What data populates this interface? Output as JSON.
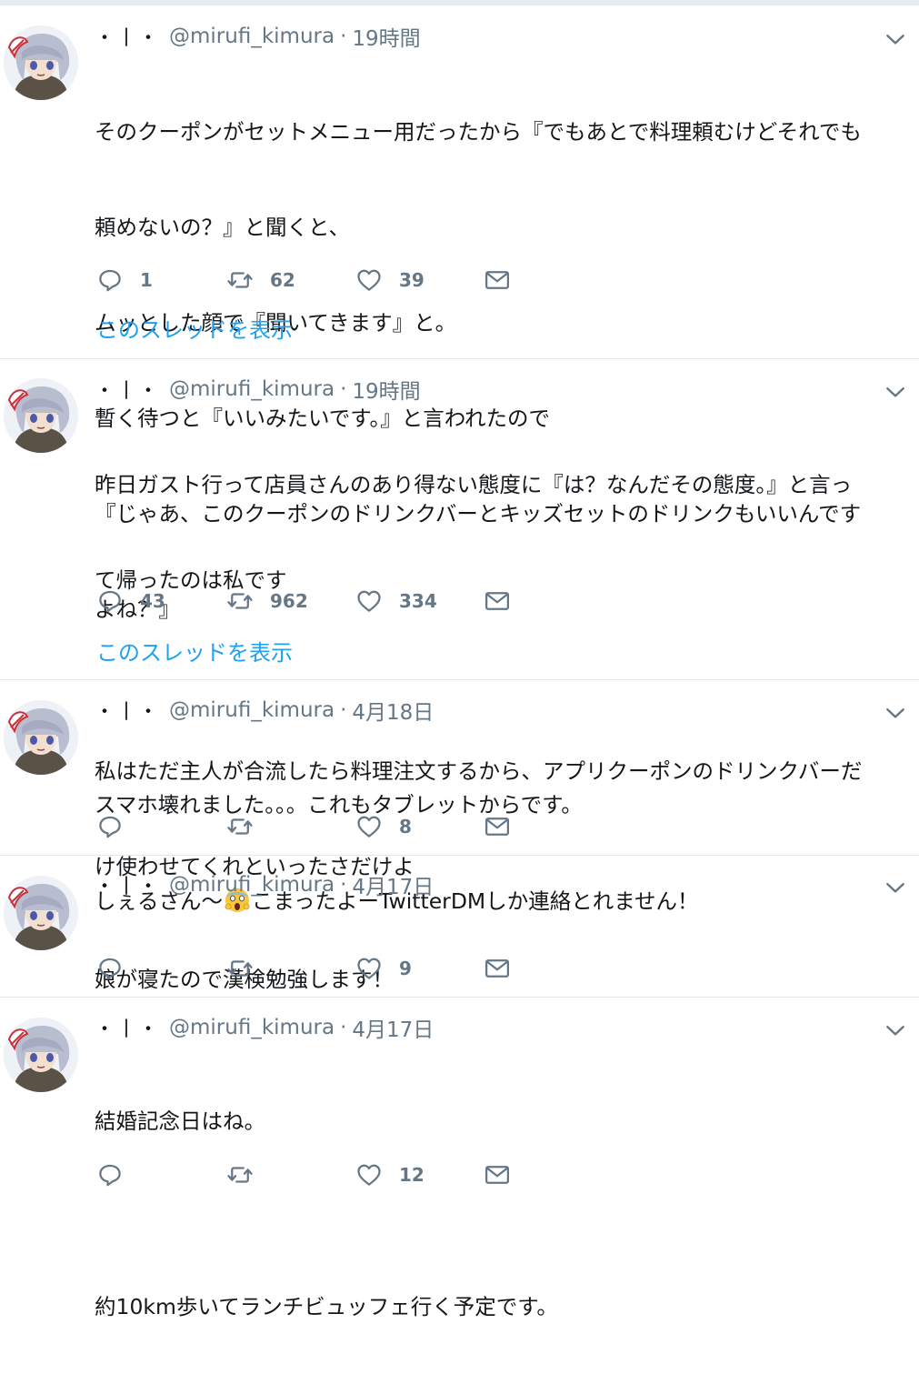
{
  "account": {
    "display_name": "・丨・",
    "handle": "@mirufi_kimura",
    "separator": "·"
  },
  "icons": {
    "reply": "reply-icon",
    "retweet": "retweet-icon",
    "like": "heart-icon",
    "dm": "envelope-icon",
    "caret": "chevron-down-icon",
    "emoji": "screaming-face-emoji"
  },
  "colors": {
    "accent": "#1da1f2",
    "muted": "#657786",
    "text": "#14171a",
    "border": "#e1e8ed"
  },
  "tweets": [
    {
      "time": "19時間",
      "lines": [
        "そのクーポンがセットメニュー用だったから『でもあとで料理頼むけどそれでも",
        "頼めないの？』と聞くと、",
        "ムッとした顔で『聞いてきます』と。",
        "暫く待つと『いいみたいです。』と言われたので",
        "『じゃあ、このクーポンのドリンクバーとキッズセットのドリンクもいいんです",
        "よね？』"
      ],
      "reply_count": "1",
      "retweet_count": "62",
      "like_count": "39",
      "thread_link": "このスレッドを表示"
    },
    {
      "time": "19時間",
      "lines": [
        "昨日ガスト行って店員さんのあり得ない態度に『は？なんだその態度。』と言っ",
        "て帰ったのは私です",
        "",
        "私はただ主人が合流したら料理注文するから、アプリクーポンのドリンクバーだ",
        "け使わせてくれといったさだけよ"
      ],
      "reply_count": "43",
      "retweet_count": "962",
      "like_count": "334",
      "thread_link": "このスレッドを表示"
    },
    {
      "time": "4月18日",
      "line1": "スマホ壊れました。。。これもタブレットからです。",
      "line2_before": "しぇるさん〜",
      "line2_after": "こまったよーTwitterDMしか連絡とれません！",
      "reply_count": "",
      "retweet_count": "",
      "like_count": "8"
    },
    {
      "time": "4月17日",
      "lines": [
        "娘が寝たので漢検勉強します！"
      ],
      "reply_count": "",
      "retweet_count": "",
      "like_count": "9"
    },
    {
      "time": "4月17日",
      "lines": [
        "結婚記念日はね。",
        "",
        "約10km歩いてランチビュッフェ行く予定です。"
      ],
      "reply_count": "",
      "retweet_count": "",
      "like_count": "12"
    }
  ]
}
